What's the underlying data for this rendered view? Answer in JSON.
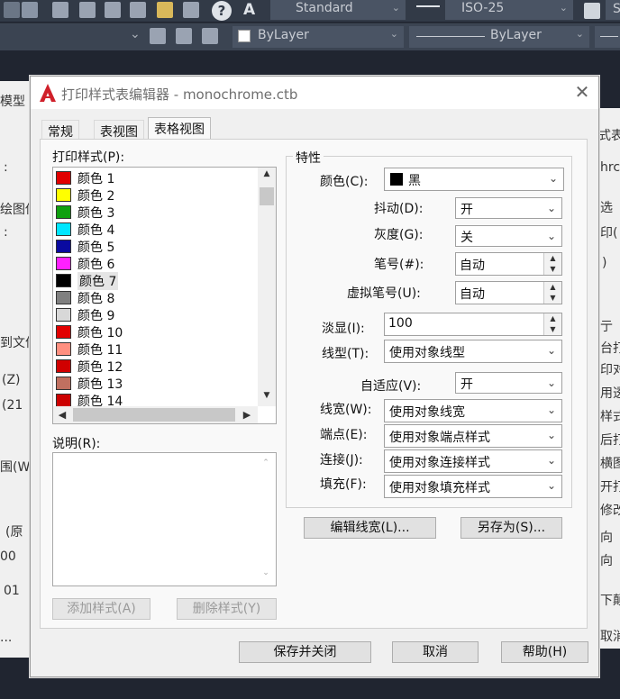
{
  "toolbar": {
    "text_style": "Standard",
    "dim_style": "ISO-25",
    "layer_color": "ByLayer",
    "linetype": "ByLayer",
    "partial_right": "S"
  },
  "background": {
    "left_fragments": [
      "模型",
      ":",
      "绘图仪",
      ":",
      "到文件",
      "(Z)",
      "(21",
      "围(W)",
      "(原",
      "00",
      "01",
      "..."
    ],
    "right_fragments": [
      "式表",
      "hrc",
      "选",
      "印(",
      ")",
      "亍",
      "台打",
      "印对",
      "用透",
      "样式",
      "后打",
      "横图",
      "开打",
      "修改",
      "向",
      "向",
      "下颠",
      "取消"
    ]
  },
  "dialog": {
    "title": "打印样式表编辑器 - monochrome.ctb",
    "tabs": [
      {
        "label": "常规"
      },
      {
        "label": "表视图"
      },
      {
        "label": "表格视图"
      }
    ],
    "styles_label": "打印样式(P):",
    "styles": [
      {
        "label": "颜色 1",
        "color": "#e10000"
      },
      {
        "label": "颜色 2",
        "color": "#ffff00"
      },
      {
        "label": "颜色 3",
        "color": "#10a010"
      },
      {
        "label": "颜色 4",
        "color": "#00e6ff"
      },
      {
        "label": "颜色 5",
        "color": "#0a0aa0"
      },
      {
        "label": "颜色 6",
        "color": "#ff20ff"
      },
      {
        "label": "颜色 7",
        "color": "#000000"
      },
      {
        "label": "颜色 8",
        "color": "#808080"
      },
      {
        "label": "颜色 9",
        "color": "#d8d8d8"
      },
      {
        "label": "颜色 10",
        "color": "#e10000"
      },
      {
        "label": "颜色 11",
        "color": "#ff9080"
      },
      {
        "label": "颜色 12",
        "color": "#d00000"
      },
      {
        "label": "颜色 13",
        "color": "#c07060"
      },
      {
        "label": "颜色 14",
        "color": "#cc0000"
      }
    ],
    "selected_style": "颜色 7",
    "description_label": "说明(R):",
    "description_value": "",
    "add_style": "添加样式(A)",
    "delete_style": "删除样式(Y)",
    "properties": {
      "group_label": "特性",
      "color_label": "颜色(C):",
      "color_value": "黑",
      "color_swatch": "#000000",
      "dither_label": "抖动(D):",
      "dither_value": "开",
      "grayscale_label": "灰度(G):",
      "grayscale_value": "关",
      "pen_label": "笔号(#):",
      "pen_value": "自动",
      "virtual_pen_label": "虚拟笔号(U):",
      "virtual_pen_value": "自动",
      "screening_label": "淡显(I):",
      "screening_value": "100",
      "linetype_label": "线型(T):",
      "linetype_value": "使用对象线型",
      "adaptive_label": "自适应(V):",
      "adaptive_value": "开",
      "lineweight_label": "线宽(W):",
      "lineweight_value": "使用对象线宽",
      "endstyle_label": "端点(E):",
      "endstyle_value": "使用对象端点样式",
      "joinstyle_label": "连接(J):",
      "joinstyle_value": "使用对象连接样式",
      "fillstyle_label": "填充(F):",
      "fillstyle_value": "使用对象填充样式"
    },
    "edit_lineweights": "编辑线宽(L)...",
    "save_as": "另存为(S)...",
    "save_close": "保存并关闭",
    "cancel": "取消",
    "help": "帮助(H)"
  }
}
